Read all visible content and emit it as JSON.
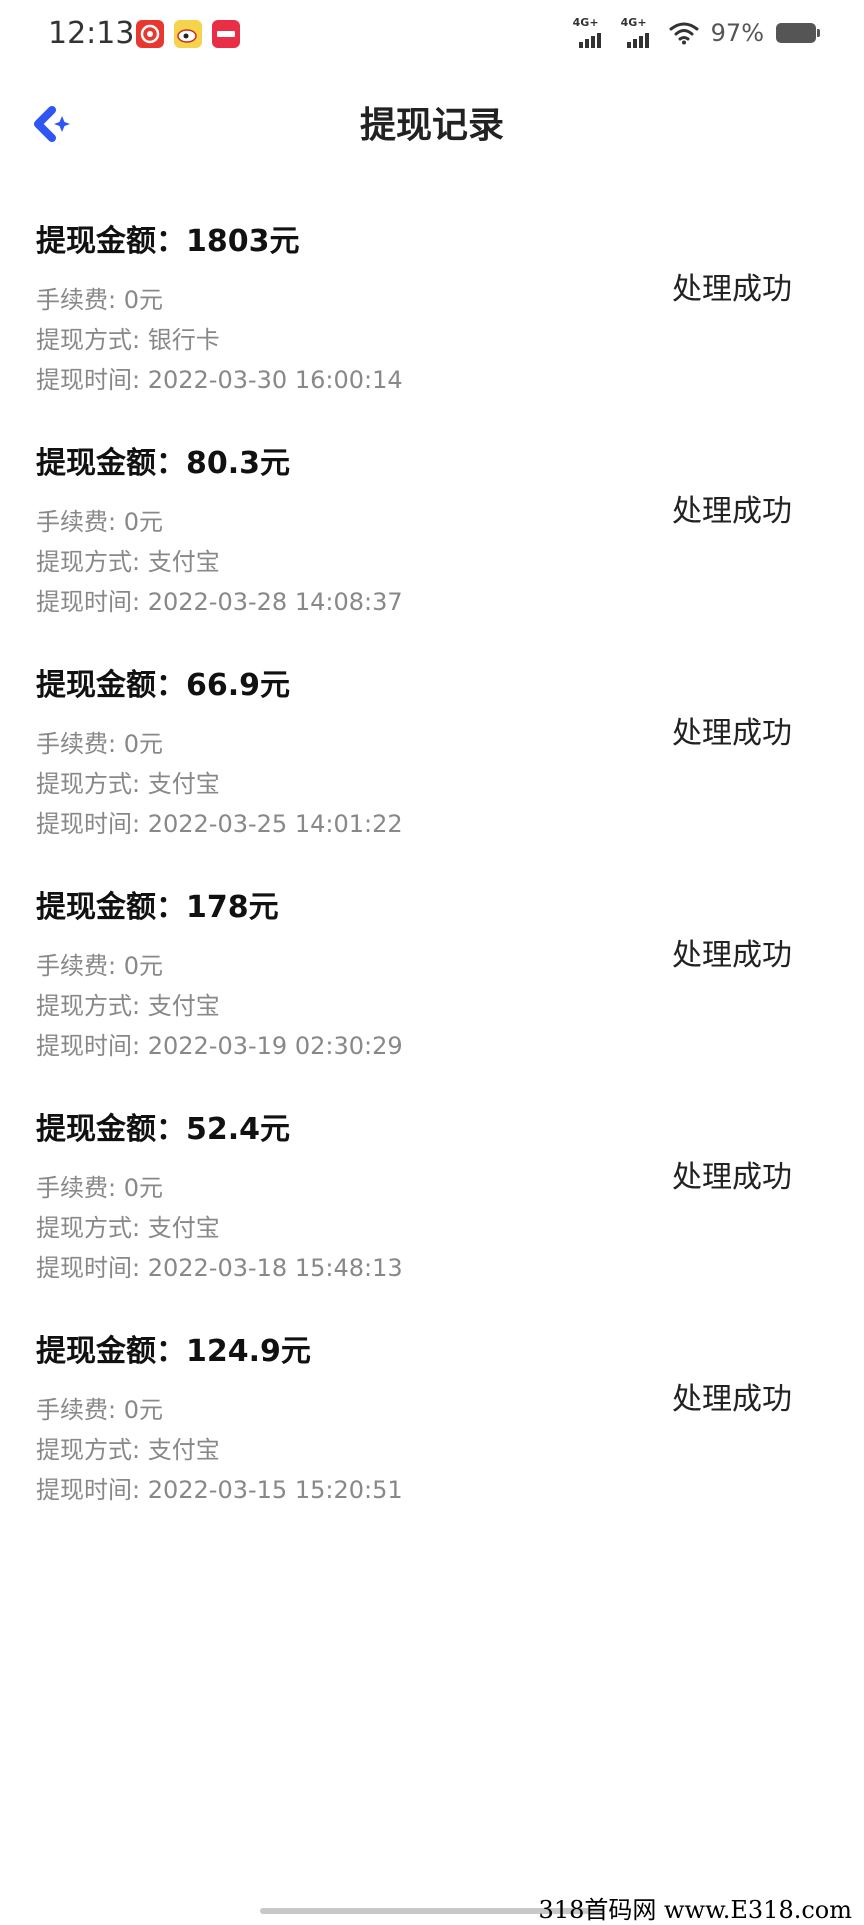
{
  "status_bar": {
    "time": "12:13",
    "notifications": [
      {
        "icon": "netease-music-icon",
        "color": "#e8372f"
      },
      {
        "icon": "weibo-icon",
        "color": "#f5d34a"
      },
      {
        "icon": "xiaohongshu-icon",
        "color": "#ea2e45"
      }
    ],
    "network_1": "4G+",
    "network_2": "4G+",
    "battery_percent": "97%"
  },
  "header": {
    "title": "提现记录",
    "back_icon": "back-arrow-icon",
    "accent_color": "#2f55f5"
  },
  "records": [
    {
      "amount": "提现金额：1803元",
      "fee": "手续费: 0元",
      "method": "提现方式: 银行卡",
      "time": "提现时间: 2022-03-30 16:00:14",
      "status": "处理成功"
    },
    {
      "amount": "提现金额：80.3元",
      "fee": "手续费: 0元",
      "method": "提现方式: 支付宝",
      "time": "提现时间: 2022-03-28 14:08:37",
      "status": "处理成功"
    },
    {
      "amount": "提现金额：66.9元",
      "fee": "手续费: 0元",
      "method": "提现方式: 支付宝",
      "time": "提现时间: 2022-03-25 14:01:22",
      "status": "处理成功"
    },
    {
      "amount": "提现金额：178元",
      "fee": "手续费: 0元",
      "method": "提现方式: 支付宝",
      "time": "提现时间: 2022-03-19 02:30:29",
      "status": "处理成功"
    },
    {
      "amount": "提现金额：52.4元",
      "fee": "手续费: 0元",
      "method": "提现方式: 支付宝",
      "time": "提现时间: 2022-03-18 15:48:13",
      "status": "处理成功"
    },
    {
      "amount": "提现金额：124.9元",
      "fee": "手续费: 0元",
      "method": "提现方式: 支付宝",
      "time": "提现时间: 2022-03-15 15:20:51",
      "status": "处理成功"
    }
  ],
  "watermark": "318首码网 www.E318.com"
}
